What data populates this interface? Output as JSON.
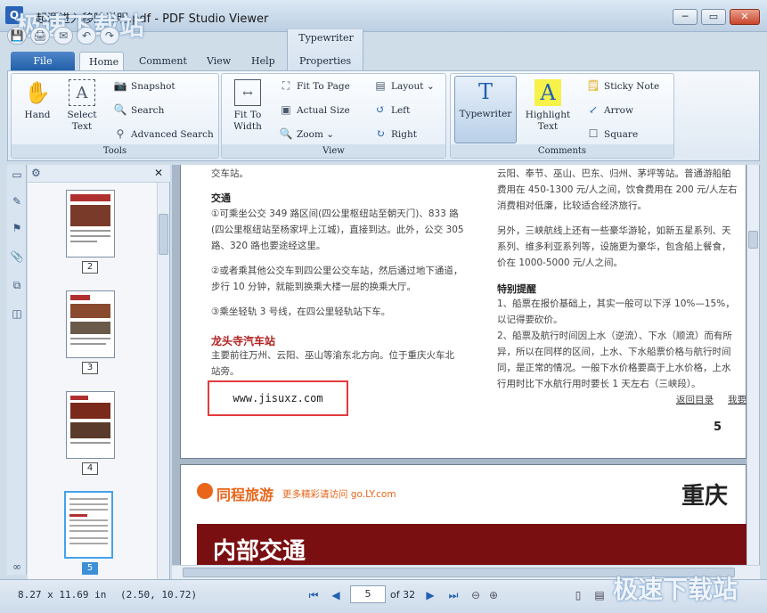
{
  "window": {
    "title": "起源进入移除说明.pdf - PDF Studio Viewer",
    "icon_letter": "Q",
    "min": "─",
    "max": "▭",
    "close": "✕"
  },
  "watermark": {
    "top_left": "极速下载站",
    "bottom_right": "极速下载站"
  },
  "quick_access": [
    "💾",
    "🖨",
    "✉",
    "↶",
    "↷"
  ],
  "tabs": {
    "file": "File",
    "home": "Home",
    "comment": "Comment",
    "view": "View",
    "help": "Help",
    "context_group": "Typewriter",
    "properties": "Properties"
  },
  "ribbon": {
    "tools": {
      "label": "Tools",
      "hand": "Hand",
      "select_text_1": "Select",
      "select_text_2": "Text",
      "snapshot": "Snapshot",
      "search": "Search",
      "advanced_search": "Advanced Search"
    },
    "view": {
      "label": "View",
      "fit_to_width_1": "Fit To",
      "fit_to_width_2": "Width",
      "fit_to_page": "Fit To Page",
      "actual_size": "Actual Size",
      "zoom": "Zoom",
      "layout": "Layout",
      "left": "Left",
      "right": "Right"
    },
    "comments": {
      "label": "Comments",
      "typewriter": "Typewriter",
      "highlight_1": "Highlight",
      "highlight_2": "Text",
      "sticky_note": "Sticky Note",
      "arrow": "Arrow",
      "square": "Square"
    }
  },
  "thumbnails": [
    {
      "num": "2"
    },
    {
      "num": "3"
    },
    {
      "num": "4"
    },
    {
      "num": "5"
    }
  ],
  "document": {
    "page5": {
      "left": {
        "top_cut": "交车站。",
        "traffic_heading": "交通",
        "lines": [
          "①可乘坐公交 349 路区间(四公里枢纽站至朝天门)、833 路",
          "(四公里枢纽站至杨家坪上江城)，直接到达。此外，公交 305",
          "路、320 路也要途经这里。",
          "②或者乘其他公交车到四公里公交车站，然后通过地下通道，",
          "步行 10 分钟，就能到换乘大楼一层的换乘大厅。",
          "③乘坐轻轨 3 号线，在四公里轻轨站下车。"
        ],
        "station_heading": "龙头寺汽车站",
        "station_lines": [
          "主要前往万州、云阳、巫山等渝东北方向。位于重庆火车北",
          "站旁。"
        ],
        "url": "www.jisuxz.com"
      },
      "right": {
        "lines1": [
          "云阳、奉节、巫山、巴东、归州、茅坪等站。普通游船舶",
          "费用在 450-1300 元/人之间，饮食费用在 200 元/人左右",
          "消费相对低廉，比较适合经济旅行。"
        ],
        "lines2": [
          "另外，三峡航线上还有一些豪华游轮，如新五星系列、天",
          "系列、维多利亚系列等，设施更为豪华，包含船上餐食，",
          "价在 1000-5000 元/人之间。"
        ],
        "tips_heading": "特别提醒",
        "tips": [
          "1、船票在报价基础上，其实一般可以下浮 10%—15%，",
          "以记得要砍价。",
          "2、船票及航行时间因上水（逆流）、下水（顺流）而有所",
          "异，所以在同样的区间，上水、下水船票价格与航行时间",
          "同，是正常的情况。一般下水价格要高于上水价格，上水",
          "行用时比下水航行用时要长 1 天左右（三峡段）。"
        ],
        "back_link": "返回目录",
        "more_link": "我要",
        "page_num": "5"
      }
    },
    "page6": {
      "brand": "同程旅游",
      "brand_sub": "更多精彩请访问 go.LY.com",
      "city": "重庆",
      "banner": "内部交通"
    }
  },
  "status": {
    "page_size": "8.27 x 11.69 in",
    "cursor": "(2.50, 10.72)",
    "current_page": "5",
    "of_pages": "of 32"
  },
  "colors": {
    "accent": "#1f5ea8",
    "banner": "#7a0f12",
    "red_heading": "#b22222",
    "brand_orange": "#e8651a"
  }
}
